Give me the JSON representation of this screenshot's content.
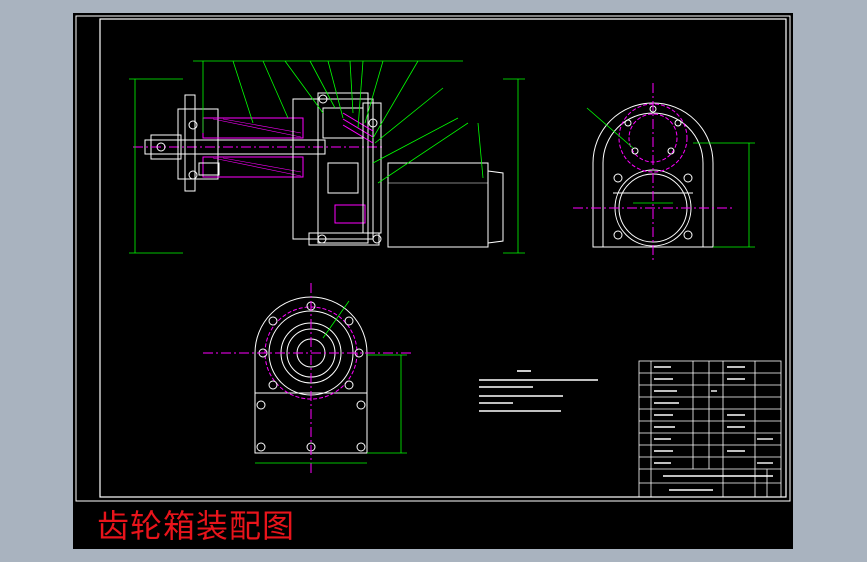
{
  "caption": "齿轮箱装配图",
  "colors": {
    "background": "#a9b3bf",
    "canvas": "#000000",
    "line": "#ffffff",
    "dimension": "#00ff00",
    "center_line": "#ff00ff",
    "caption": "#e8141b",
    "hatch": "#ff00ff"
  }
}
